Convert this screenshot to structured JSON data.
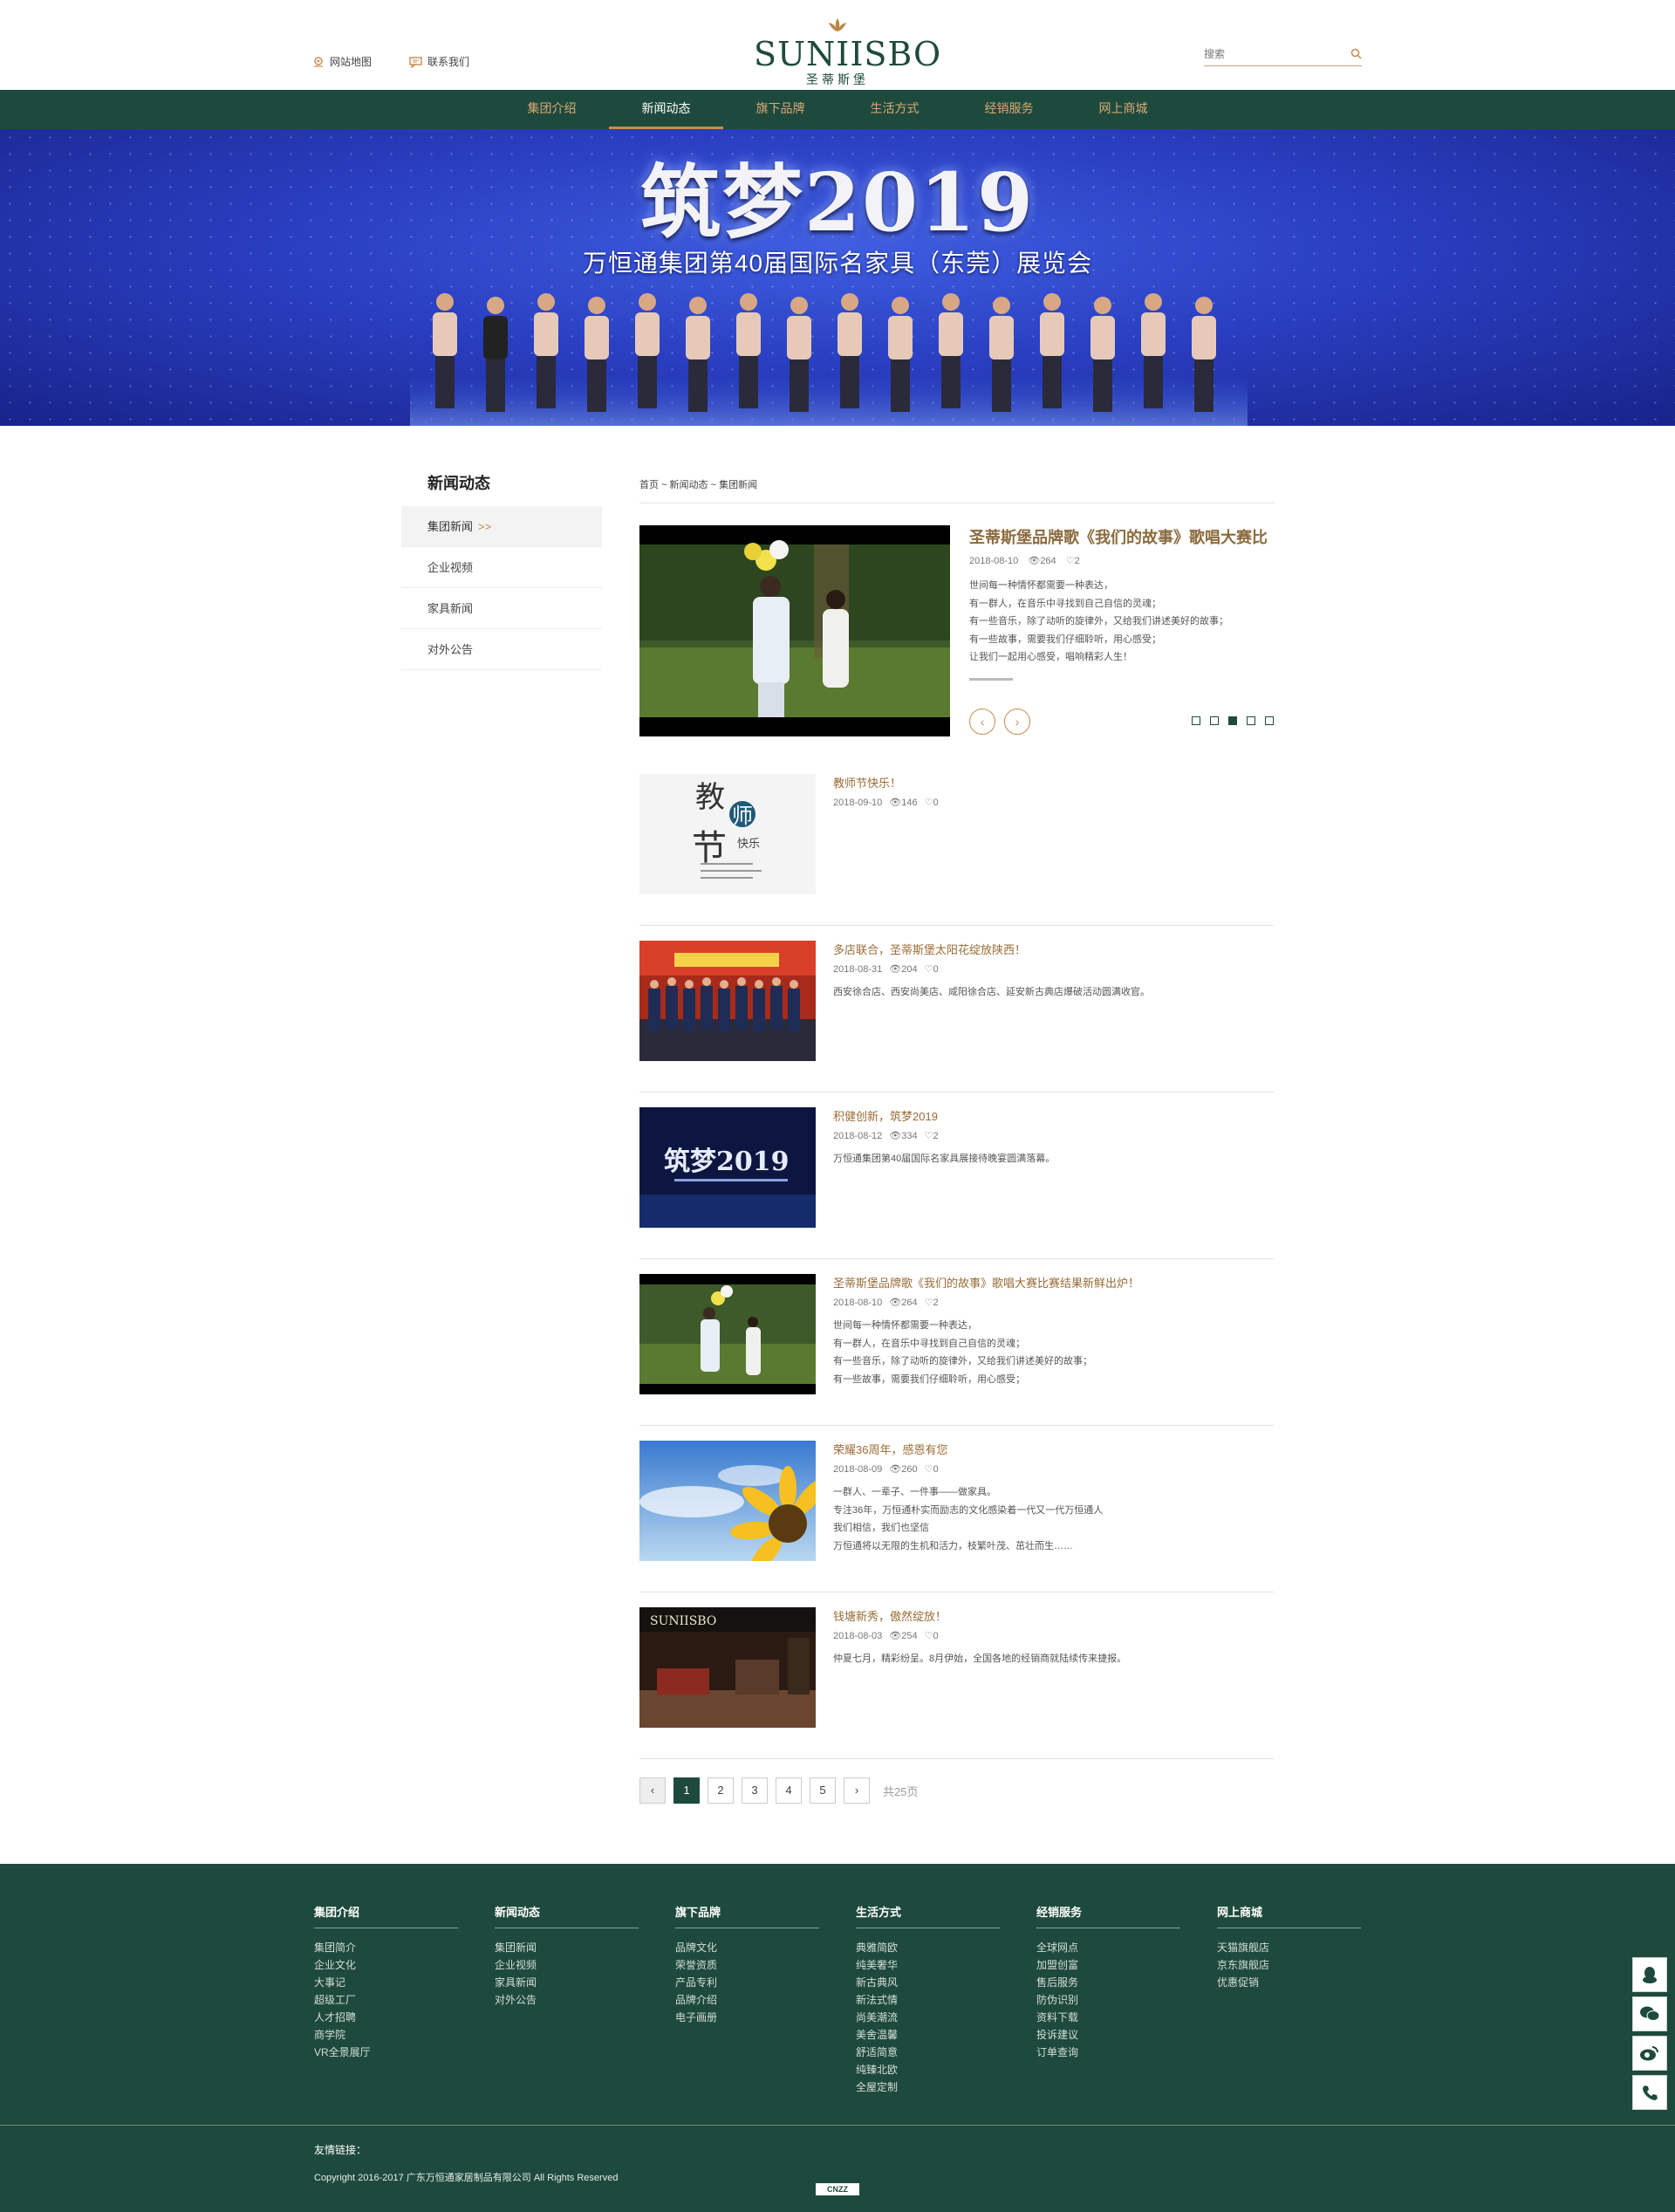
{
  "header": {
    "sitemap": "网站地图",
    "contact": "联系我们",
    "logo_en": "SUNIISBO",
    "logo_cn": "圣蒂斯堡",
    "search_placeholder": "搜索"
  },
  "nav": [
    "集团介绍",
    "新闻动态",
    "旗下品牌",
    "生活方式",
    "经销服务",
    "网上商城"
  ],
  "banner": {
    "title": "筑梦2019",
    "subtitle": "万恒通集团第40届国际名家具（东莞）展览会"
  },
  "sidebar": {
    "title": "新闻动态",
    "items": [
      "集团新闻",
      "企业视频",
      "家具新闻",
      "对外公告"
    ],
    "arrow": ">>"
  },
  "breadcrumb": "首页 ~ 新闻动态 ~ 集团新闻",
  "feature": {
    "title": "圣蒂斯堡品牌歌《我们的故事》歌唱大赛比",
    "date": "2018-08-10",
    "views": "264",
    "likes": "2",
    "lines": [
      "世间每一种情怀都需要一种表达，",
      "有一群人，在音乐中寻找到自己自信的灵魂；",
      "有一些音乐，除了动听的旋律外，又给我们讲述美好的故事；",
      "有一些故事，需要我们仔细聆听，用心感受；",
      "让我们一起用心感受，唱响精彩人生！"
    ],
    "prev": "‹",
    "next": "›"
  },
  "news": [
    {
      "title": "教师节快乐！",
      "date": "2018-09-10",
      "views": "146",
      "likes": "0",
      "lines": []
    },
    {
      "title": "多店联合，圣蒂斯堡太阳花绽放陕西！",
      "date": "2018-08-31",
      "views": "204",
      "likes": "0",
      "lines": [
        "西安徐合店、西安尚美店、咸阳徐合店、延安新古典店爆破活动圆满收官。"
      ]
    },
    {
      "title": "积健创新，筑梦2019",
      "date": "2018-08-12",
      "views": "334",
      "likes": "2",
      "lines": [
        "万恒通集团第40届国际名家具展接待晚宴圆满落幕。"
      ]
    },
    {
      "title": "圣蒂斯堡品牌歌《我们的故事》歌唱大赛比赛结果新鲜出炉！",
      "date": "2018-08-10",
      "views": "264",
      "likes": "2",
      "lines": [
        "世间每一种情怀都需要一种表达，",
        "有一群人，在音乐中寻找到自己自信的灵魂；",
        "有一些音乐，除了动听的旋律外，又给我们讲述美好的故事；",
        "有一些故事，需要我们仔细聆听，用心感受；"
      ]
    },
    {
      "title": "荣耀36周年，感恩有您",
      "date": "2018-08-09",
      "views": "260",
      "likes": "0",
      "lines": [
        "一群人、一辈子、一件事——做家具。",
        "专注36年，万恒通朴实而励志的文化感染着一代又一代万恒通人",
        "我们相信，我们也坚信",
        "万恒通将以无限的生机和活力，枝繁叶茂、茁壮而生……"
      ]
    },
    {
      "title": "钱塘新秀，傲然绽放！",
      "date": "2018-08-03",
      "views": "254",
      "likes": "0",
      "lines": [
        "仲夏七月，精彩纷呈。8月伊始，全国各地的经销商就陆续传来捷报。"
      ]
    }
  ],
  "news_image_text": {
    "teacher": [
      "教",
      "师",
      "节",
      "快乐"
    ],
    "shop_sign": "SUNIISBO"
  },
  "pager": {
    "prev": "‹",
    "pages": [
      "1",
      "2",
      "3",
      "4",
      "5"
    ],
    "next": "›",
    "total": "共25页"
  },
  "footer": {
    "columns": [
      {
        "title": "集团介绍",
        "links": [
          "集团简介",
          "企业文化",
          "大事记",
          "超级工厂",
          "人才招聘",
          "商学院",
          "VR全景展厅"
        ]
      },
      {
        "title": "新闻动态",
        "links": [
          "集团新闻",
          "企业视频",
          "家具新闻",
          "对外公告"
        ]
      },
      {
        "title": "旗下品牌",
        "links": [
          "品牌文化",
          "荣誉资质",
          "产品专利",
          "品牌介绍",
          "电子画册"
        ]
      },
      {
        "title": "生活方式",
        "links": [
          "典雅简欧",
          "纯美奢华",
          "新古典风",
          "新法式情",
          "尚美潮流",
          "美舍温馨",
          "舒适简意",
          "纯臻北欧",
          "全屋定制"
        ]
      },
      {
        "title": "经销服务",
        "links": [
          "全球网点",
          "加盟创富",
          "售后服务",
          "防伪识别",
          "资料下载",
          "投诉建议",
          "订单查询"
        ]
      },
      {
        "title": "网上商城",
        "links": [
          "天猫旗舰店",
          "京东旗舰店",
          "优惠促销"
        ]
      }
    ],
    "friend_links": "友情链接：",
    "copyright": "Copyright 2016-2017 广东万恒通家居制品有限公司 All Rights Reserved",
    "cnzz": "CNZZ"
  },
  "colors": {
    "brand_green": "#1e4a3d",
    "accent_gold": "#c88b4f",
    "banner_blue": "#2a3fc2"
  }
}
